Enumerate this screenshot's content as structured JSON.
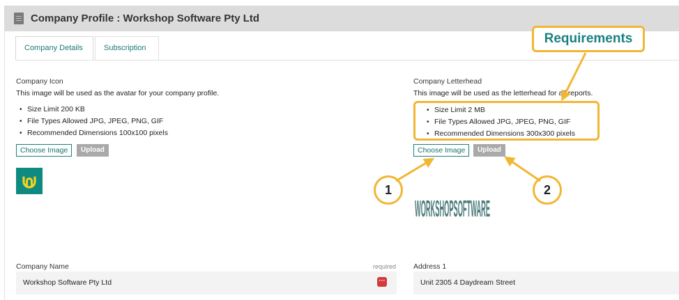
{
  "header": {
    "title": "Company Profile :  Workshop Software Pty Ltd",
    "icon": "building-icon"
  },
  "tabs": [
    {
      "label": "Company Details",
      "active": true
    },
    {
      "label": "Subscription",
      "active": false
    }
  ],
  "company_icon": {
    "label": "Company Icon",
    "description": "This image will be used as the avatar for your company profile.",
    "requirements": [
      "Size Limit 200 KB",
      "File Types Allowed JPG, JPEG, PNG, GIF",
      "Recommended Dimensions 100x100 pixels"
    ],
    "choose_label": "Choose Image",
    "upload_label": "Upload",
    "preview": "company-logo-icon"
  },
  "company_letterhead": {
    "label": "Company Letterhead",
    "description": "This image will be used as the letterhead for all reports.",
    "requirements": [
      "Size Limit 2 MB",
      "File Types Allowed JPG, JPEG, PNG, GIF",
      "Recommended Dimensions 300x300 pixels"
    ],
    "choose_label": "Choose Image",
    "upload_label": "Upload",
    "preview_text": "WORKSHOPSOFTWARE"
  },
  "annotations": {
    "requirements_label": "Requirements",
    "step1": "1",
    "step2": "2",
    "color": "#f2b632"
  },
  "form": {
    "company_name_label": "Company Name",
    "required_tag": "required",
    "company_name_value": "Workshop Software Pty Ltd",
    "address1_label": "Address 1",
    "address1_value": "Unit 2305 4 Daydream Street"
  },
  "colors": {
    "accent": "#1a8080",
    "upload_button": "#a9a9a9",
    "header_bg": "#dcdcdc",
    "logo_bg": "#0f8a80",
    "required_icon": "#d33b3b"
  }
}
